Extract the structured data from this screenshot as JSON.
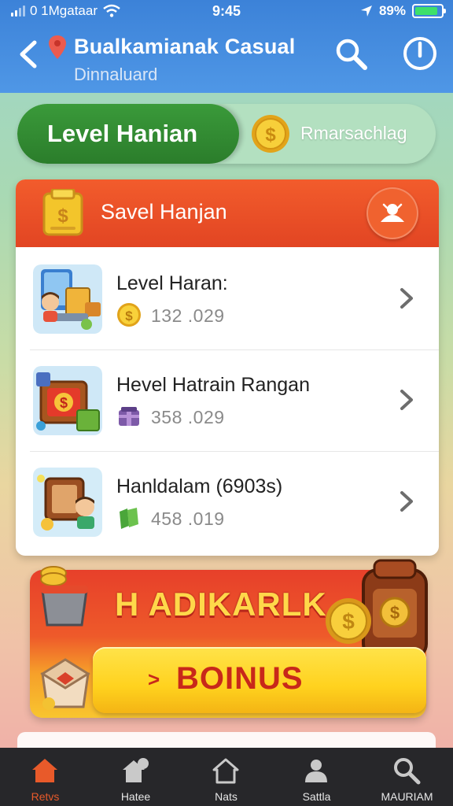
{
  "status_bar": {
    "carrier": "0 1Mgataar",
    "time": "9:45",
    "battery": "89%"
  },
  "header": {
    "title": "Bualkamianak Casual",
    "subtitle": "Dinnaluard"
  },
  "level_pill": {
    "label": "Level Hanian",
    "right_text": "Rmarsachlag"
  },
  "card": {
    "title": "Savel Hanjan",
    "rows": [
      {
        "title": "Level Haran:",
        "value": "132 .029",
        "icon": "coin-icon"
      },
      {
        "title": "Hevel Hatrain Rangan",
        "value": "358 .029",
        "icon": "gift-icon"
      },
      {
        "title": "Hanldalam (6903s)",
        "value": "458 .019",
        "icon": "cash-icon"
      }
    ]
  },
  "banner": {
    "title": "H ADIKARLK",
    "button_arrow": ">",
    "button_label": "BOINUS"
  },
  "tabs": [
    {
      "label": "Retvs",
      "icon": "home-icon",
      "active": true
    },
    {
      "label": "Hatee",
      "icon": "house-icon",
      "active": false
    },
    {
      "label": "Nats",
      "icon": "house-outline-icon",
      "active": false
    },
    {
      "label": "Sattla",
      "icon": "user-icon",
      "active": false
    },
    {
      "label": "MAURIAM",
      "icon": "search-icon",
      "active": false
    }
  ],
  "colors": {
    "header_blue": "#3c82d8",
    "accent_green": "#2b7d2b",
    "card_red": "#e24523",
    "tab_active": "#e85a2a",
    "tab_bar": "#27272a"
  }
}
